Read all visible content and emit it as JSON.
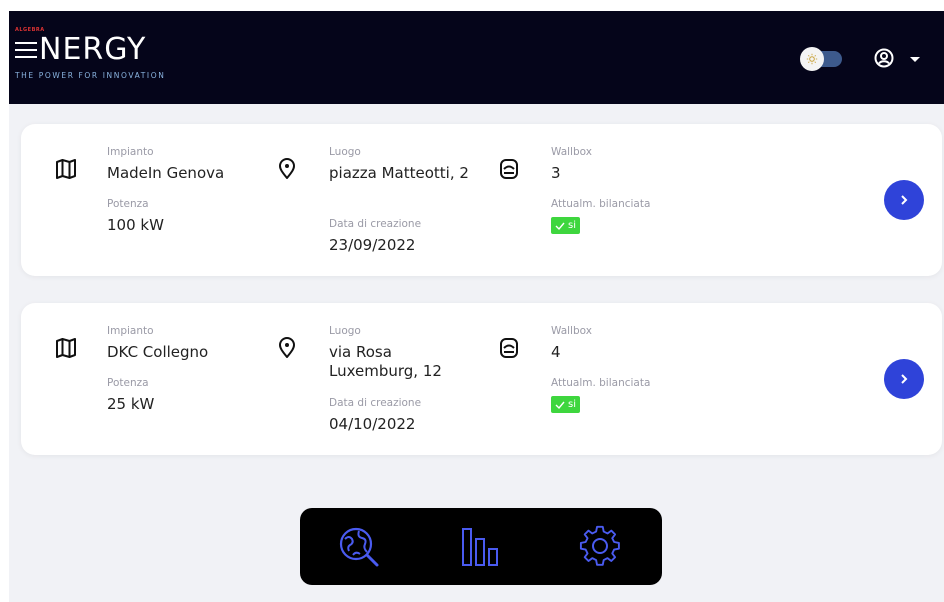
{
  "header": {
    "logo_top": "ALGEBRA",
    "logo_word": "NERGY",
    "logo_tagline": "THE POWER FOR INNOVATION",
    "theme_toggle_icon": "sun-icon",
    "user_icon": "user-circle-icon"
  },
  "colors": {
    "header_bg": "#05051a",
    "accent": "#2f43d9",
    "badge_green": "#3ed63e",
    "nav_icon": "#4a5bf0"
  },
  "plants": [
    {
      "impianto_label": "Impianto",
      "impianto": "MadeIn Genova",
      "potenza_label": "Potenza",
      "potenza": "100 kW",
      "luogo_label": "Luogo",
      "luogo": "piazza Matteotti, 2",
      "data_label": "Data di creazione",
      "data": "23/09/2022",
      "wallbox_label": "Wallbox",
      "wallbox": "3",
      "bilanciata_label": "Attualm. bilanciata",
      "bilanciata": "si"
    },
    {
      "impianto_label": "Impianto",
      "impianto": "DKC Collegno",
      "potenza_label": "Potenza",
      "potenza": "25 kW",
      "luogo_label": "Luogo",
      "luogo": "via Rosa Luxemburg, 12",
      "data_label": "Data di creazione",
      "data": "04/10/2022",
      "wallbox_label": "Wallbox",
      "wallbox": "4",
      "bilanciata_label": "Attualm. bilanciata",
      "bilanciata": "si"
    }
  ],
  "bottom_nav": {
    "items": [
      "globe-search-icon",
      "bar-chart-icon",
      "gear-icon"
    ]
  }
}
